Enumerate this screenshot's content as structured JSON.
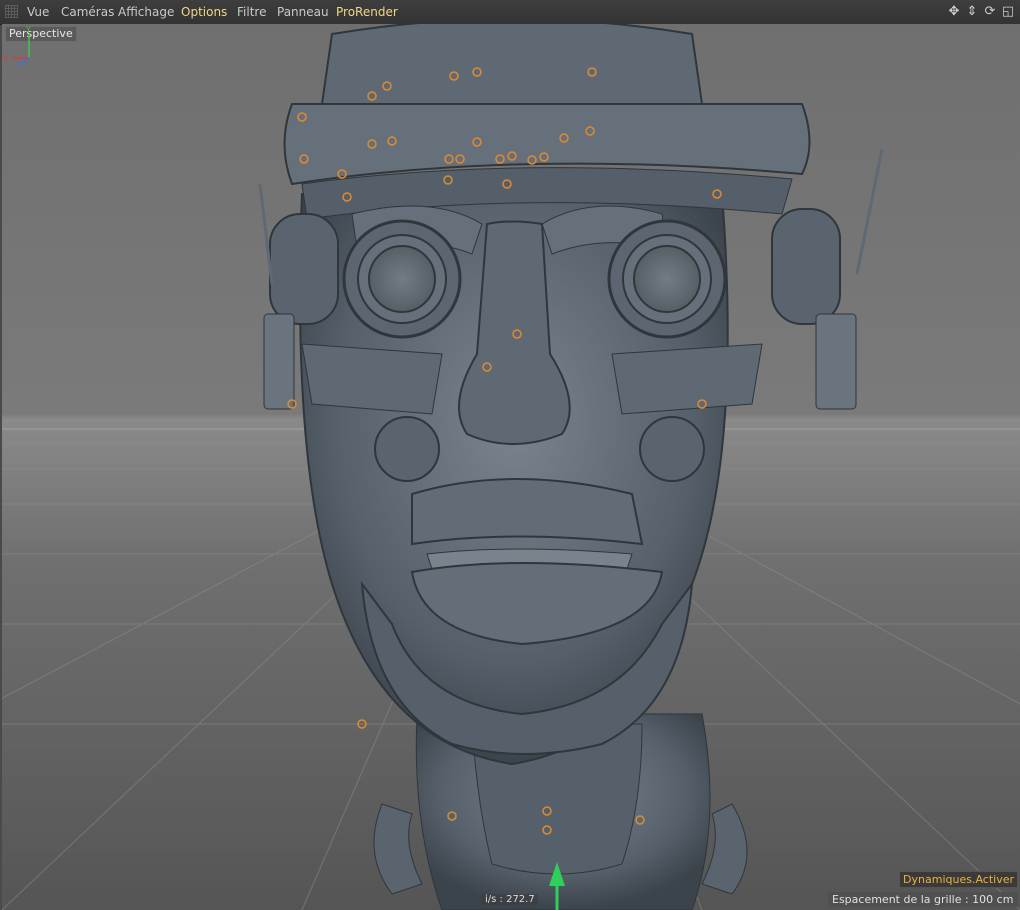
{
  "menu": {
    "items": [
      {
        "label": "Vue",
        "highlight": false
      },
      {
        "label": "Caméras",
        "highlight": false
      },
      {
        "label": "Affichage",
        "highlight": false
      },
      {
        "label": "Options",
        "highlight": true
      },
      {
        "label": "Filtre",
        "highlight": false
      },
      {
        "label": "Panneau",
        "highlight": false
      },
      {
        "label": "ProRender",
        "highlight": true
      }
    ],
    "nav_icons": [
      "move-view-icon",
      "pan-view-icon",
      "rotate-view-icon",
      "maximize-view-icon"
    ]
  },
  "viewport": {
    "camera_label": "Perspective",
    "fps": "i/s : 272.7",
    "dynamics_status": "Dynamiques.Activer",
    "grid_spacing": "Espacement de la grille : 100 cm",
    "axes": {
      "y": "Y",
      "x": "X",
      "z": "Z"
    }
  },
  "colors": {
    "menu_highlight": "#f0d888",
    "selection_orange": "#e08a30",
    "model_gray": "#5d6670",
    "dynamics_text": "#f0b040"
  }
}
